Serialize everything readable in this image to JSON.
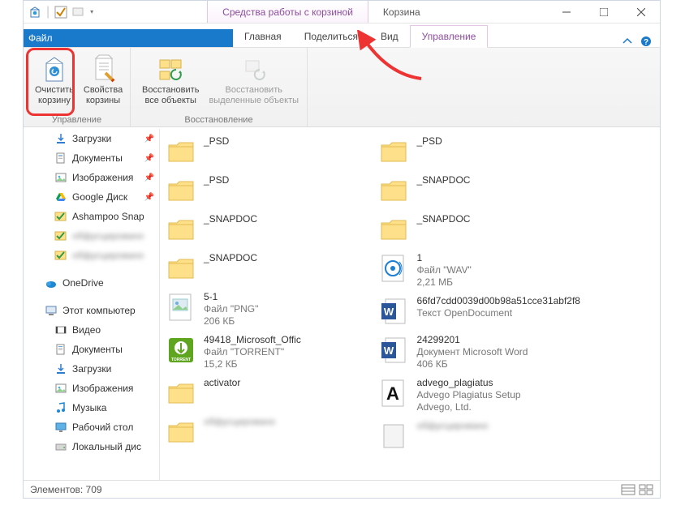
{
  "titlebar": {
    "context_tab": "Средства работы с корзиной",
    "title": "Корзина"
  },
  "tabs": {
    "file": "Файл",
    "main": "Главная",
    "share": "Поделиться",
    "view": "Вид",
    "manage": "Управление"
  },
  "ribbon": {
    "empty_bin": "Очистить\nкорзину",
    "bin_props": "Свойства\nкорзины",
    "restore_all": "Восстановить\nвсе объекты",
    "restore_sel": "Восстановить\nвыделенные объекты",
    "group_manage": "Управление",
    "group_restore": "Восстановление"
  },
  "sidebar": [
    {
      "label": "Загрузки",
      "icon": "downloads",
      "pinned": true,
      "lv": 2
    },
    {
      "label": "Документы",
      "icon": "documents",
      "pinned": true,
      "lv": 2
    },
    {
      "label": "Изображения",
      "icon": "pictures",
      "pinned": true,
      "lv": 2
    },
    {
      "label": "Google Диск",
      "icon": "gdrive",
      "pinned": true,
      "lv": 2
    },
    {
      "label": "Ashampoo Snap",
      "icon": "check",
      "lv": 2,
      "clip": true
    },
    {
      "label": "обфусцировано",
      "icon": "check",
      "lv": 2,
      "blur": true
    },
    {
      "label": "обфусцировано",
      "icon": "check",
      "lv": 2,
      "blur": true
    },
    {
      "label": "",
      "spacer": true
    },
    {
      "label": "OneDrive",
      "icon": "onedrive",
      "lv": 1
    },
    {
      "label": "",
      "spacer": true
    },
    {
      "label": "Этот компьютер",
      "icon": "pc",
      "lv": 1
    },
    {
      "label": "Видео",
      "icon": "video",
      "lv": 2
    },
    {
      "label": "Документы",
      "icon": "documents",
      "lv": 2
    },
    {
      "label": "Загрузки",
      "icon": "downloads",
      "lv": 2
    },
    {
      "label": "Изображения",
      "icon": "pictures",
      "lv": 2
    },
    {
      "label": "Музыка",
      "icon": "music",
      "lv": 2
    },
    {
      "label": "Рабочий стол",
      "icon": "desktop",
      "lv": 2
    },
    {
      "label": "Локальный дис",
      "icon": "disk",
      "lv": 2,
      "clip": true
    }
  ],
  "files_left": [
    {
      "icon": "folder",
      "name": "_PSD"
    },
    {
      "icon": "folder",
      "name": "_PSD"
    },
    {
      "icon": "folder",
      "name": "_SNAPDOC"
    },
    {
      "icon": "folder",
      "name": "_SNAPDOC"
    },
    {
      "icon": "png",
      "name": "5-1",
      "l2": "Файл \"PNG\"",
      "l3": "206 КБ"
    },
    {
      "icon": "torrent",
      "name": "49418_Microsoft_Offic",
      "l2": "Файл \"TORRENT\"",
      "l3": "15,2 КБ"
    },
    {
      "icon": "folder",
      "name": "activator"
    },
    {
      "icon": "folder",
      "name": "обфусцировано",
      "blur": true
    }
  ],
  "files_right": [
    {
      "icon": "folder",
      "name": "_PSD"
    },
    {
      "icon": "folder",
      "name": "_SNAPDOC"
    },
    {
      "icon": "folder",
      "name": "_SNAPDOC"
    },
    {
      "icon": "wav",
      "name": "1",
      "l2": "Файл \"WAV\"",
      "l3": "2,21 МБ"
    },
    {
      "icon": "word",
      "name": "66fd7cdd0039d00b98a51cce31abf2f8",
      "l2": "Текст OpenDocument"
    },
    {
      "icon": "word",
      "name": "24299201",
      "l2": "Документ Microsoft Word",
      "l3": "406 КБ"
    },
    {
      "icon": "advego",
      "name": "advego_plagiatus",
      "l2": "Advego Plagiatus Setup",
      "l3": "Advego, Ltd."
    },
    {
      "icon": "generic",
      "name": "обфусцировано",
      "blur": true
    }
  ],
  "status": {
    "elements_label": "Элементов:",
    "elements_count": "709"
  }
}
